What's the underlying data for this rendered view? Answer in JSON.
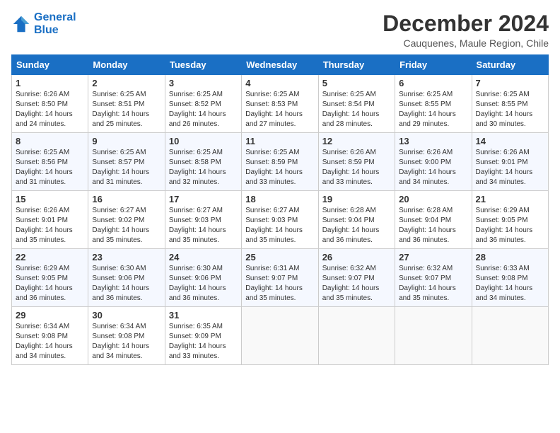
{
  "header": {
    "logo_line1": "General",
    "logo_line2": "Blue",
    "month_title": "December 2024",
    "location": "Cauquenes, Maule Region, Chile"
  },
  "weekdays": [
    "Sunday",
    "Monday",
    "Tuesday",
    "Wednesday",
    "Thursday",
    "Friday",
    "Saturday"
  ],
  "weeks": [
    [
      {
        "day": "1",
        "info": "Sunrise: 6:26 AM\nSunset: 8:50 PM\nDaylight: 14 hours\nand 24 minutes."
      },
      {
        "day": "2",
        "info": "Sunrise: 6:25 AM\nSunset: 8:51 PM\nDaylight: 14 hours\nand 25 minutes."
      },
      {
        "day": "3",
        "info": "Sunrise: 6:25 AM\nSunset: 8:52 PM\nDaylight: 14 hours\nand 26 minutes."
      },
      {
        "day": "4",
        "info": "Sunrise: 6:25 AM\nSunset: 8:53 PM\nDaylight: 14 hours\nand 27 minutes."
      },
      {
        "day": "5",
        "info": "Sunrise: 6:25 AM\nSunset: 8:54 PM\nDaylight: 14 hours\nand 28 minutes."
      },
      {
        "day": "6",
        "info": "Sunrise: 6:25 AM\nSunset: 8:55 PM\nDaylight: 14 hours\nand 29 minutes."
      },
      {
        "day": "7",
        "info": "Sunrise: 6:25 AM\nSunset: 8:55 PM\nDaylight: 14 hours\nand 30 minutes."
      }
    ],
    [
      {
        "day": "8",
        "info": "Sunrise: 6:25 AM\nSunset: 8:56 PM\nDaylight: 14 hours\nand 31 minutes."
      },
      {
        "day": "9",
        "info": "Sunrise: 6:25 AM\nSunset: 8:57 PM\nDaylight: 14 hours\nand 31 minutes."
      },
      {
        "day": "10",
        "info": "Sunrise: 6:25 AM\nSunset: 8:58 PM\nDaylight: 14 hours\nand 32 minutes."
      },
      {
        "day": "11",
        "info": "Sunrise: 6:25 AM\nSunset: 8:59 PM\nDaylight: 14 hours\nand 33 minutes."
      },
      {
        "day": "12",
        "info": "Sunrise: 6:26 AM\nSunset: 8:59 PM\nDaylight: 14 hours\nand 33 minutes."
      },
      {
        "day": "13",
        "info": "Sunrise: 6:26 AM\nSunset: 9:00 PM\nDaylight: 14 hours\nand 34 minutes."
      },
      {
        "day": "14",
        "info": "Sunrise: 6:26 AM\nSunset: 9:01 PM\nDaylight: 14 hours\nand 34 minutes."
      }
    ],
    [
      {
        "day": "15",
        "info": "Sunrise: 6:26 AM\nSunset: 9:01 PM\nDaylight: 14 hours\nand 35 minutes."
      },
      {
        "day": "16",
        "info": "Sunrise: 6:27 AM\nSunset: 9:02 PM\nDaylight: 14 hours\nand 35 minutes."
      },
      {
        "day": "17",
        "info": "Sunrise: 6:27 AM\nSunset: 9:03 PM\nDaylight: 14 hours\nand 35 minutes."
      },
      {
        "day": "18",
        "info": "Sunrise: 6:27 AM\nSunset: 9:03 PM\nDaylight: 14 hours\nand 35 minutes."
      },
      {
        "day": "19",
        "info": "Sunrise: 6:28 AM\nSunset: 9:04 PM\nDaylight: 14 hours\nand 36 minutes."
      },
      {
        "day": "20",
        "info": "Sunrise: 6:28 AM\nSunset: 9:04 PM\nDaylight: 14 hours\nand 36 minutes."
      },
      {
        "day": "21",
        "info": "Sunrise: 6:29 AM\nSunset: 9:05 PM\nDaylight: 14 hours\nand 36 minutes."
      }
    ],
    [
      {
        "day": "22",
        "info": "Sunrise: 6:29 AM\nSunset: 9:05 PM\nDaylight: 14 hours\nand 36 minutes."
      },
      {
        "day": "23",
        "info": "Sunrise: 6:30 AM\nSunset: 9:06 PM\nDaylight: 14 hours\nand 36 minutes."
      },
      {
        "day": "24",
        "info": "Sunrise: 6:30 AM\nSunset: 9:06 PM\nDaylight: 14 hours\nand 36 minutes."
      },
      {
        "day": "25",
        "info": "Sunrise: 6:31 AM\nSunset: 9:07 PM\nDaylight: 14 hours\nand 35 minutes."
      },
      {
        "day": "26",
        "info": "Sunrise: 6:32 AM\nSunset: 9:07 PM\nDaylight: 14 hours\nand 35 minutes."
      },
      {
        "day": "27",
        "info": "Sunrise: 6:32 AM\nSunset: 9:07 PM\nDaylight: 14 hours\nand 35 minutes."
      },
      {
        "day": "28",
        "info": "Sunrise: 6:33 AM\nSunset: 9:08 PM\nDaylight: 14 hours\nand 34 minutes."
      }
    ],
    [
      {
        "day": "29",
        "info": "Sunrise: 6:34 AM\nSunset: 9:08 PM\nDaylight: 14 hours\nand 34 minutes."
      },
      {
        "day": "30",
        "info": "Sunrise: 6:34 AM\nSunset: 9:08 PM\nDaylight: 14 hours\nand 34 minutes."
      },
      {
        "day": "31",
        "info": "Sunrise: 6:35 AM\nSunset: 9:09 PM\nDaylight: 14 hours\nand 33 minutes."
      },
      {
        "day": "",
        "info": ""
      },
      {
        "day": "",
        "info": ""
      },
      {
        "day": "",
        "info": ""
      },
      {
        "day": "",
        "info": ""
      }
    ]
  ]
}
